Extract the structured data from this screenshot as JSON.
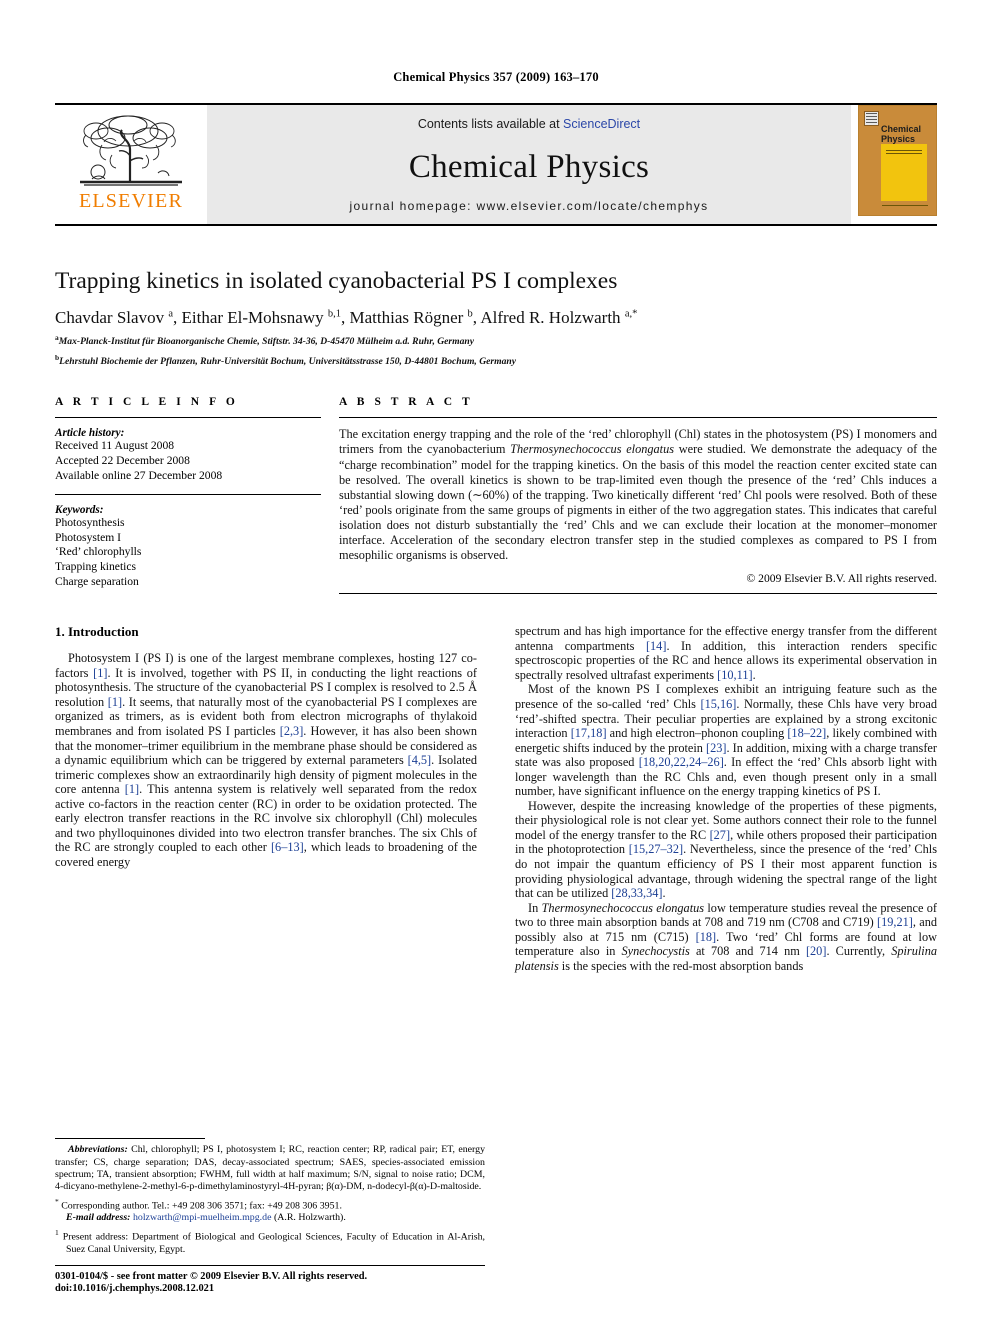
{
  "running_head": "Chemical Physics 357 (2009) 163–170",
  "banner": {
    "publisher_logo_text": "ELSEVIER",
    "contents_prefix": "Contents lists available at",
    "contents_link": "ScienceDirect",
    "journal_title": "Chemical Physics",
    "homepage": "journal homepage: www.elsevier.com/locate/chemphys",
    "cover_title_line1": "Chemical",
    "cover_title_line2": "Physics"
  },
  "article": {
    "title": "Trapping kinetics in isolated cyanobacterial PS I complexes",
    "authors_html": "Chavdar Slavov <sup>a</sup>, Eithar El-Mohsnawy <sup>b,1</sup>, Matthias Rögner <sup>b</sup>, Alfred R. Holzwarth <sup>a,*</sup>",
    "affiliation_a": "Max-Planck-Institut für Bioanorganische Chemie, Stiftstr. 34-36, D-45470 Mülheim a.d. Ruhr, Germany",
    "affiliation_b": "Lehrstuhl Biochemie der Pflanzen, Ruhr-Universität Bochum, Universitätsstrasse 150, D-44801 Bochum, Germany"
  },
  "article_info": {
    "heading": "A R T I C L E   I N F O",
    "history_label": "Article history:",
    "history": [
      "Received 11 August 2008",
      "Accepted 22 December 2008",
      "Available online 27 December 2008"
    ],
    "keywords_label": "Keywords:",
    "keywords": [
      "Photosynthesis",
      "Photosystem I",
      "‘Red’ chlorophylls",
      "Trapping kinetics",
      "Charge separation"
    ]
  },
  "abstract": {
    "heading": "A B S T R A C T",
    "text": "The excitation energy trapping and the role of the ‘red’ chlorophyll (Chl) states in the photosystem (PS) I monomers and trimers from the cyanobacterium Thermosynechococcus elongatus were studied. We demonstrate the adequacy of the “charge recombination” model for the trapping kinetics. On the basis of this model the reaction center excited state can be resolved. The overall kinetics is shown to be trap-limited even though the presence of the ‘red’ Chls induces a substantial slowing down (∼60%) of the trapping. Two kinetically different ‘red’ Chl pools were resolved. Both of these ‘red’ pools originate from the same groups of pigments in either of the two aggregation states. This indicates that careful isolation does not disturb substantially the ‘red’ Chls and we can exclude their location at the monomer–monomer interface. Acceleration of the secondary electron transfer step in the studied complexes as compared to PS I from mesophilic organisms is observed.",
    "copyright": "© 2009 Elsevier B.V. All rights reserved."
  },
  "body": {
    "section_heading": "1. Introduction",
    "left_paragraphs": [
      "Photosystem I (PS I) is one of the largest membrane complexes, hosting 127 co-factors [1]. It is involved, together with PS II, in conducting the light reactions of photosynthesis. The structure of the cyanobacterial PS I complex is resolved to 2.5 Å resolution [1]. It seems, that naturally most of the cyanobacterial PS I complexes are organized as trimers, as is evident both from electron micrographs of thylakoid membranes and from isolated PS I particles [2,3]. However, it has also been shown that the monomer–trimer equilibrium in the membrane phase should be considered as a dynamic equilibrium which can be triggered by external parameters [4,5]. Isolated trimeric complexes show an extraordinarily high density of pigment molecules in the core antenna [1]. This antenna system is relatively well separated from the redox active co-factors in the reaction center (RC) in order to be oxidation protected. The early electron transfer reactions in the RC involve six chlorophyll (Chl) molecules and two phylloquinones divided into two electron transfer branches. The six Chls of the RC are strongly coupled to each other [6–13], which leads to broadening of the covered energy"
    ],
    "right_paragraphs": [
      "spectrum and has high importance for the effective energy transfer from the different antenna compartments [14]. In addition, this interaction renders specific spectroscopic properties of the RC and hence allows its experimental observation in spectrally resolved ultrafast experiments [10,11].",
      "Most of the known PS I complexes exhibit an intriguing feature such as the presence of the so-called ‘red’ Chls [15,16]. Normally, these Chls have very broad ‘red’-shifted spectra. Their peculiar properties are explained by a strong excitonic interaction [17,18] and high electron–phonon coupling [18–22], likely combined with energetic shifts induced by the protein [23]. In addition, mixing with a charge transfer state was also proposed [18,20,22,24–26]. In effect the ‘red’ Chls absorb light with longer wavelength than the RC Chls and, even though present only in a small number, have significant influence on the energy trapping kinetics of PS I.",
      "However, despite the increasing knowledge of the properties of these pigments, their physiological role is not clear yet. Some authors connect their role to the funnel model of the energy transfer to the RC [27], while others proposed their participation in the photoprotection [15,27–32]. Nevertheless, since the presence of the ‘red’ Chls do not impair the quantum efficiency of PS I their most apparent function is providing physiological advantage, through widening the spectral range of the light that can be utilized [28,33,34].",
      "In Thermosynechococcus elongatus low temperature studies reveal the presence of two to three main absorption bands at 708 and 719 nm (C708 and C719) [19,21], and possibly also at 715 nm (C715) [18]. Two ‘red’ Chl forms are found at low temperature also in Synechocystis at 708 and 714 nm [20]. Currently, Spirulina platensis is the species with the red-most absorption bands"
    ]
  },
  "footnotes": {
    "abbreviations_label": "Abbreviations:",
    "abbreviations_text": "Chl, chlorophyll; PS I, photosystem I; RC, reaction center; RP, radical pair; ET, energy transfer; CS, charge separation; DAS, decay-associated spectrum; SAES, species-associated emission spectrum; TA, transient absorption; FWHM, full width at half maximum; S/N, signal to noise ratio; DCM, 4-dicyano-methylene-2-methyl-6-p-dimethylaminostyryl-4H-pyran; β(α)-DM, n-dodecyl-β(α)-D-maltoside.",
    "corresponding_marker": "*",
    "corresponding_text": "Corresponding author. Tel.: +49 208 306 3571; fax: +49 208 306 3951.",
    "email_label": "E-mail address:",
    "email": "holzwarth@mpi-muelheim.mpg.de",
    "email_suffix": "(A.R. Holzwarth).",
    "present_address_marker": "1",
    "present_address": "Present address: Department of Biological and Geological Sciences, Faculty of Education in Al-Arish, Suez Canal University, Egypt.",
    "issn_line": "0301-0104/$ - see front matter © 2009 Elsevier B.V. All rights reserved.",
    "doi_line": "doi:10.1016/j.chemphys.2008.12.021"
  },
  "colors": {
    "link_blue": "#2b47a8",
    "citation_blue": "#1c3f94",
    "elsevier_orange": "#F07D00",
    "banner_gray": "#e9e9e9",
    "cover_orange": "#c98b3a",
    "cover_yellow": "#f2c40e"
  }
}
